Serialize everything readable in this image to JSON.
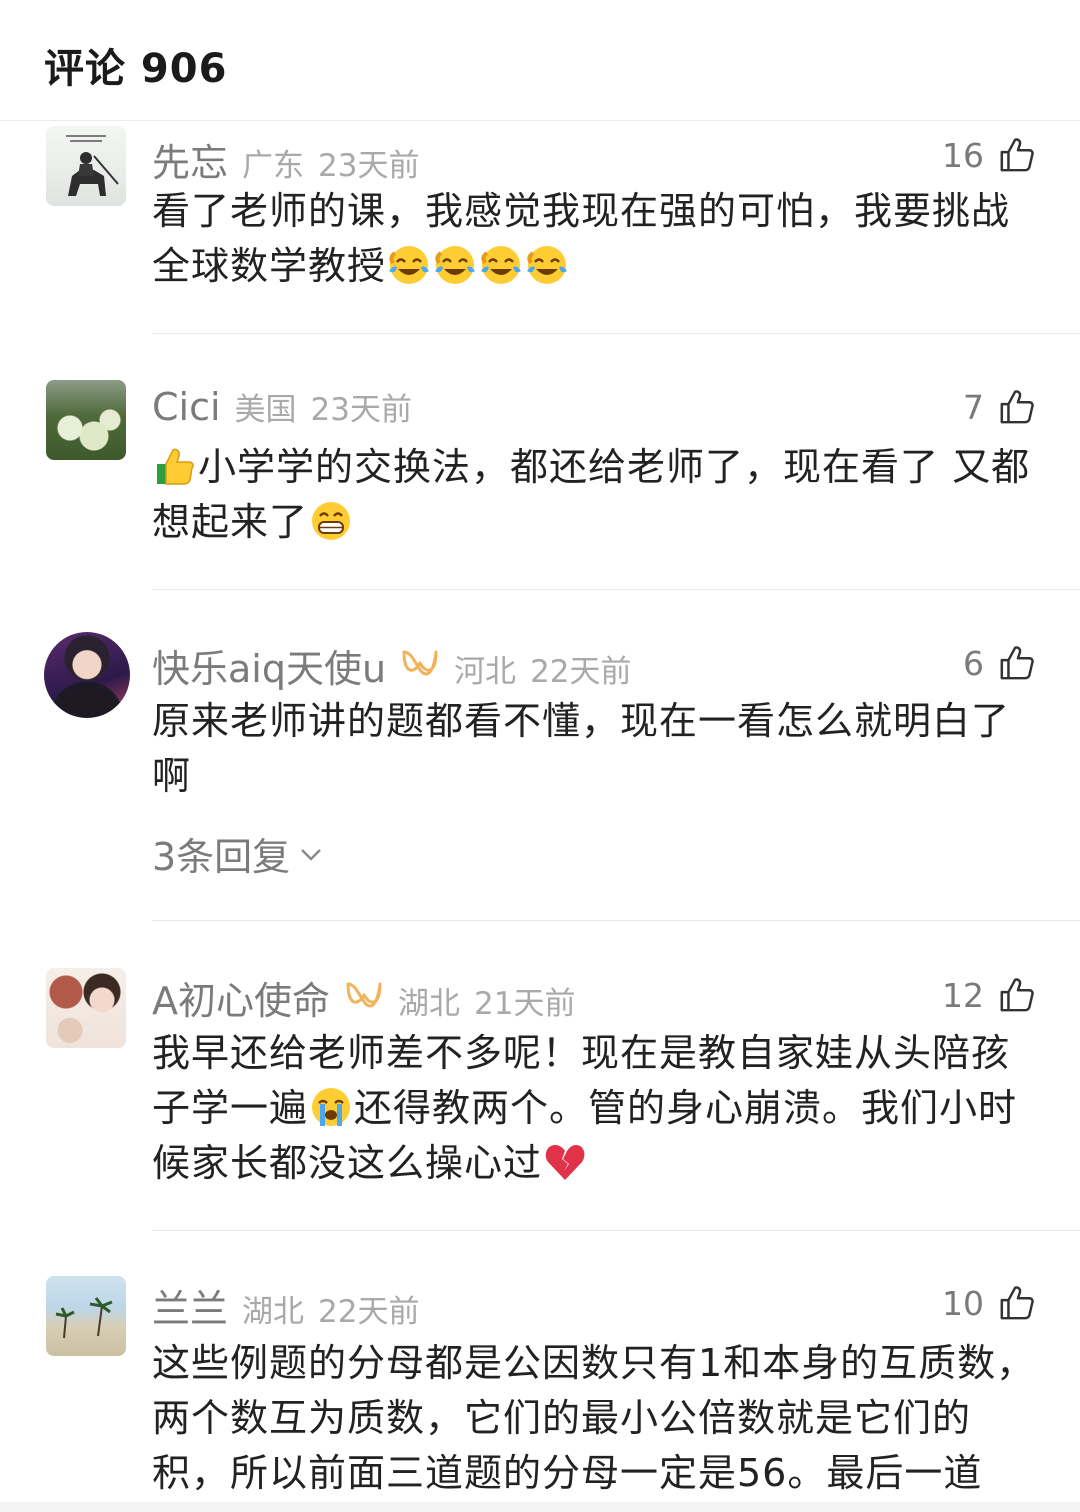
{
  "header": {
    "title": "评论 906"
  },
  "comments": [
    {
      "name": "先忘",
      "location": "广东",
      "time": "23天前",
      "likes": "16",
      "text_1": "看了老师的课，我感觉我现在强的可怕，我要挑战全球数学教授",
      "emoji_1": "laughing-crying-emoji"
    },
    {
      "name": "Cici",
      "location": "美国",
      "time": "23天前",
      "likes": "7",
      "text_1": "小学学的交换法，都还给老师了，现在看了 又都想起来了",
      "emoji_lead": "thumbs-up-emoji",
      "emoji_tail": "grinning-emoji"
    },
    {
      "name": "快乐aiq天使u",
      "location": "河北",
      "time": "22天前",
      "likes": "6",
      "text_1": "原来老师讲的题都看不懂，现在一看怎么就明白了啊",
      "replies": "3条回复"
    },
    {
      "name": "A初心使命",
      "location": "湖北",
      "time": "21天前",
      "likes": "12",
      "text_1": "我早还给老师差不多呢！现在是教自家娃从头陪孩子学一遍",
      "text_2": "还得教两个。管的身心崩溃。我们小时候家长都没这么操心过",
      "emoji_mid": "crying-emoji",
      "emoji_tail": "broken-heart-emoji"
    },
    {
      "name": "兰兰",
      "location": "湖北",
      "time": "22天前",
      "likes": "10",
      "text_1": "这些例题的分母都是公因数只有1和本身的互质数，两个数互为质数，它们的最小公倍数就是它们的积，所以前面三道题的分母一定是56。最后一道"
    }
  ],
  "icons": {
    "like": "thumbs-up-outline-icon",
    "vip": "vip-badge-icon",
    "expand": "chevron-down-icon"
  },
  "colors": {
    "name": "#7b7b7b",
    "meta": "#a9a9a9",
    "text": "#222222",
    "vip_badge": "#f2b35a"
  }
}
